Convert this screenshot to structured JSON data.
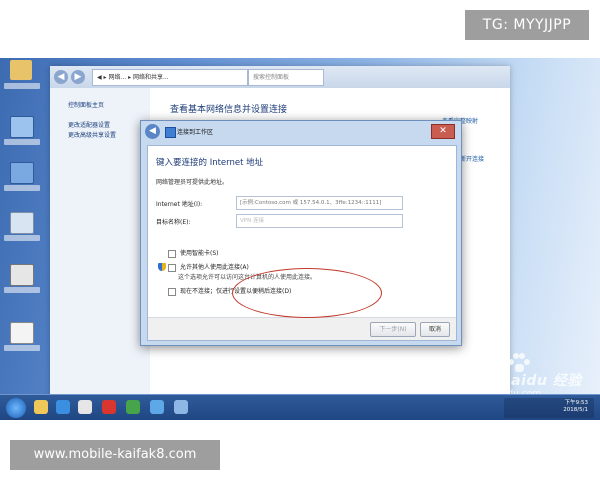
{
  "overlay": {
    "tg_badge": "TG: MYYJJPP",
    "url_badge": "www.mobile-kaifak8.com"
  },
  "explorer": {
    "address_path": "◀ ▸ 网络... ▸ 网络和共享...",
    "search_placeholder": "搜索控制面板",
    "left_links": [
      "控制面板主页",
      "更改适配器设置",
      "更改高级共享设置"
    ],
    "main_title": "查看基本网络信息并设置连接",
    "main_links": [
      "查看完整映射",
      "连接或断开连接"
    ]
  },
  "dialog": {
    "title": "连接到工作区",
    "close_label": "✕",
    "heading": "键入要连接的 Internet 地址",
    "description": "网络管理员可提供此地址。",
    "internet_address_label": "Internet 地址(I):",
    "internet_address_placeholder": "[示例:Contoso.com 或 157.54.0.1、3ffe:1234::1111]",
    "destination_name_label": "目标名称(E):",
    "destination_name_value": "VPN 连接",
    "options": [
      "使用智能卡(S)",
      "允许其他人使用此连接(A)",
      "这个选项允许可以访问这台计算机的人使用此连接。",
      "现在不连接；仅进行设置以便稍后连接(D)"
    ],
    "next_button": "下一步(N)",
    "cancel_button": "取消"
  },
  "taskbar": {
    "time": "下午9:53",
    "date": "2018/5/1"
  },
  "watermark": {
    "brand": "Baidu 经验",
    "sub": "jingyan.baidu.com"
  },
  "colors": {
    "desktop_blue": "#5e8cd1",
    "annotation_red": "#c0392b",
    "badge_gray": "#9e9e9e"
  }
}
